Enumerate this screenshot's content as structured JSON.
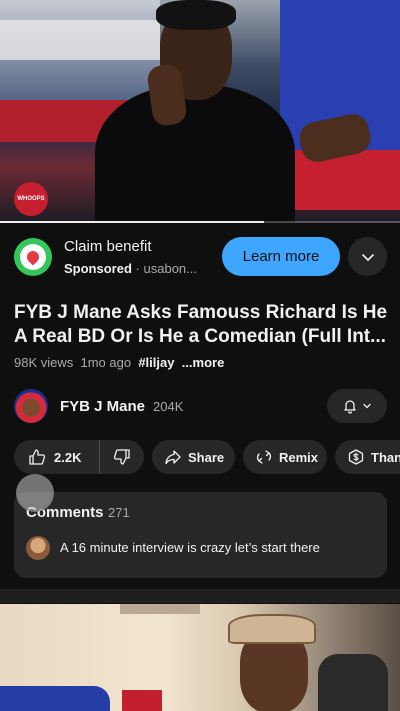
{
  "player": {
    "channel_logo_text": "WHOOPS",
    "progress": 0.66
  },
  "ad": {
    "title": "Claim benefit",
    "sponsored": "Sponsored",
    "separator": "·",
    "advertiser": "usabon...",
    "cta": "Learn more",
    "accent_color": "#3ea6ff"
  },
  "video": {
    "title": "FYB J Mane Asks Famouss Richard Is He A Real BD Or Is He a Comedian (Full Int...",
    "views": "98K views",
    "age": "1mo ago",
    "tag": "#liljay",
    "more": "...more"
  },
  "channel": {
    "name": "FYB J Mane",
    "subscribers": "204K"
  },
  "actions": {
    "likes": "2.2K",
    "share": "Share",
    "remix": "Remix",
    "thanks": "Thanks"
  },
  "comments": {
    "heading": "Comments",
    "count": "271",
    "top_comment": "A 16 minute interview is crazy let’s start there"
  },
  "icons": {
    "dropdown": "chevron-down-icon",
    "bell": "bell-icon",
    "like": "thumb-up-icon",
    "dislike": "thumb-down-icon",
    "share": "share-icon",
    "remix": "remix-icon",
    "thanks": "dollar-icon"
  }
}
